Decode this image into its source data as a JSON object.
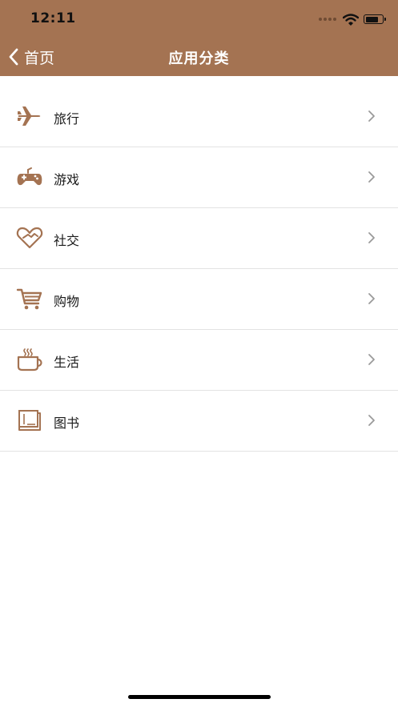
{
  "status_bar": {
    "time": "12:11"
  },
  "nav": {
    "back_label": "首页",
    "title": "应用分类"
  },
  "categories": [
    {
      "label": "旅行",
      "icon": "airplane-icon"
    },
    {
      "label": "游戏",
      "icon": "gamepad-icon"
    },
    {
      "label": "社交",
      "icon": "handshake-heart-icon"
    },
    {
      "label": "购物",
      "icon": "shopping-cart-icon"
    },
    {
      "label": "生活",
      "icon": "coffee-cup-icon"
    },
    {
      "label": "图书",
      "icon": "book-icon"
    }
  ],
  "colors": {
    "header_background": "#a47352",
    "icon_color": "#a47352",
    "chevron_color": "#9a9a9a",
    "divider": "#e3e3e3"
  }
}
